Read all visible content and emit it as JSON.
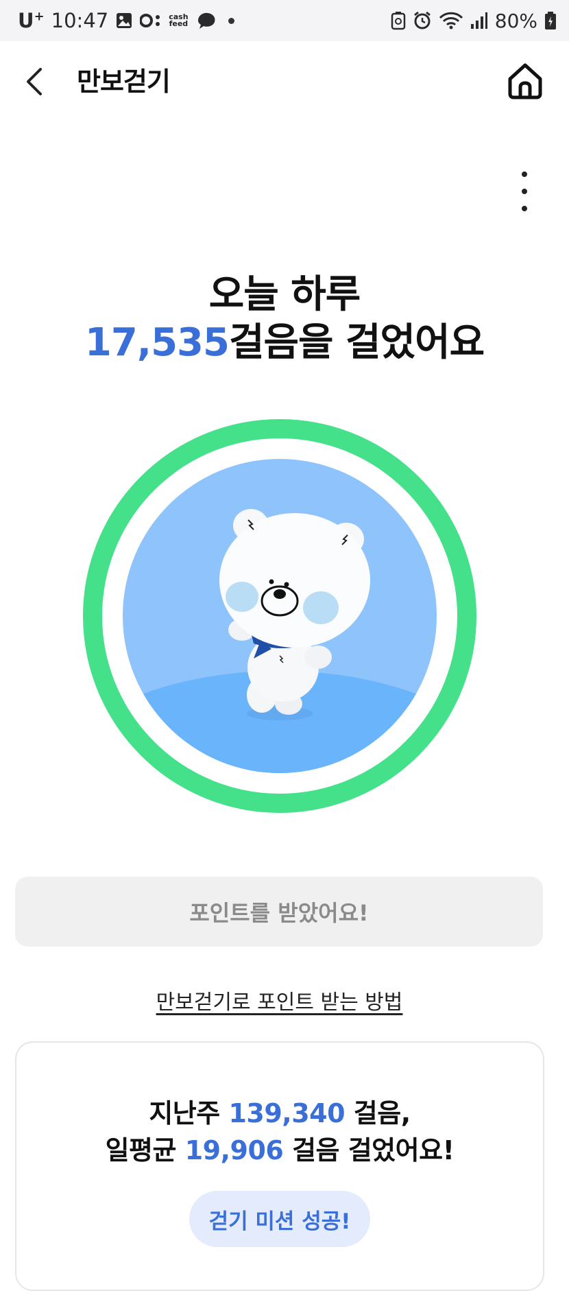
{
  "status_bar": {
    "carrier": "U",
    "carrier_sup": "+",
    "time": "10:47",
    "cashfeed_line1": "cash",
    "cashfeed_line2": "feed",
    "battery": "80%",
    "icons": [
      "gallery-icon",
      "toggle-icon",
      "cashfeed-icon",
      "chat-icon",
      "notification-dot",
      "recycle-icon",
      "alarm-icon",
      "wifi-icon",
      "signal-icon",
      "battery-icon"
    ]
  },
  "header": {
    "title": "만보걷기",
    "back_icon": "chevron-left-icon",
    "home_icon": "home-icon"
  },
  "headline": {
    "line1": "오늘 하루",
    "steps": "17,535",
    "line2_suffix": "걸음을 걸었어요"
  },
  "progress_ring": {
    "ring_color": "#44e08a",
    "inner_color": "#8ec3fb",
    "ground_color": "#6ab4fb",
    "progress": 1.0,
    "character": "white-bear-character"
  },
  "points_button": {
    "label": "포인트를 받았어요!"
  },
  "howto_link": {
    "label": "만보걷기로 포인트 받는 방법"
  },
  "weekly": {
    "line1_prefix": "지난주 ",
    "week_steps": "139,340",
    "line1_suffix": " 걸음,",
    "line2_prefix": "일평균 ",
    "avg_steps": "19,906",
    "line2_suffix": " 걸음 걸었어요!",
    "mission_label": "걷기 미션 성공!"
  },
  "colors": {
    "accent_blue": "#3a6fd8",
    "ring_green": "#44e08a",
    "pill_bg": "#e4ebfc"
  }
}
